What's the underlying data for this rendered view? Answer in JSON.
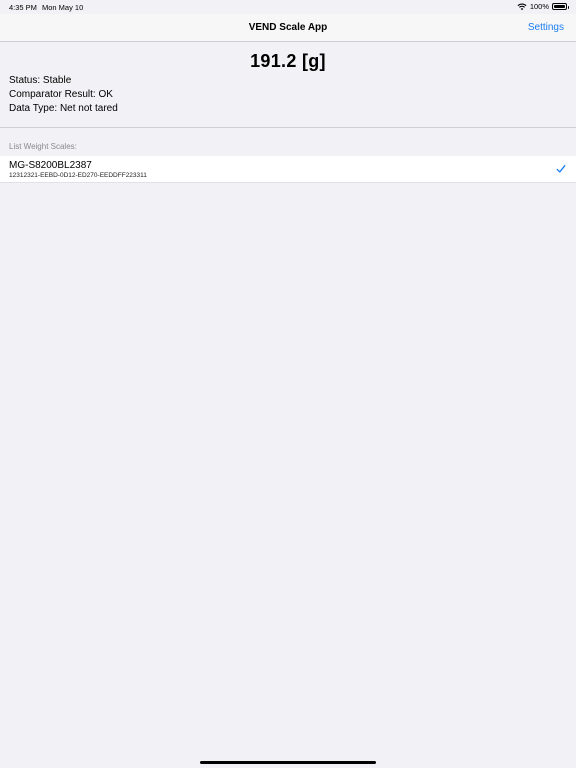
{
  "status_bar": {
    "time": "4:35 PM",
    "date": "Mon May 10",
    "battery": "100%",
    "icons": [
      "wifi-icon",
      "battery-icon"
    ]
  },
  "nav": {
    "title": "VEND Scale App",
    "settings_label": "Settings"
  },
  "weight": {
    "value": "191.2 [g]"
  },
  "info": {
    "status": "Status: Stable",
    "comparator": "Comparator Result: OK",
    "data_type": "Data Type: Net not tared"
  },
  "list": {
    "header": "List Weight Scales:",
    "items": [
      {
        "name": "MG-S8200BL2387",
        "id": "12312321-EEBD-0D12-ED270-EEDDFF223311",
        "selected": true,
        "icon": "checkmark-icon"
      }
    ]
  },
  "colors": {
    "background": "#f2f2f6",
    "accent": "#1a7ef2"
  }
}
